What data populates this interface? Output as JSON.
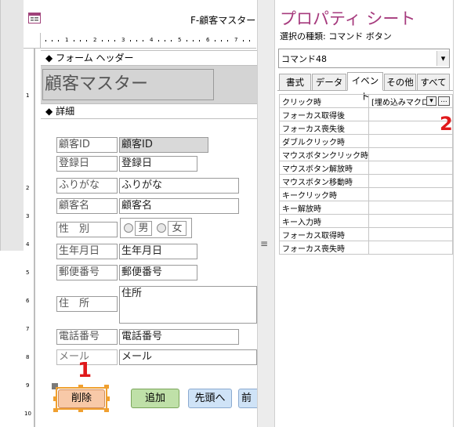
{
  "form": {
    "title": "F-顧客マスター",
    "header_section": "フォーム ヘッダー",
    "header_title": "顧客マスター",
    "detail_section": "詳細",
    "ruler_top": [
      "1",
      "2",
      "3",
      "4",
      "5",
      "6",
      "7"
    ],
    "ruler_left": [
      "1",
      "2",
      "3",
      "4",
      "5",
      "6",
      "7",
      "8",
      "9",
      "10"
    ],
    "fields": [
      {
        "label": "顧客ID",
        "value": "顧客ID"
      },
      {
        "label": "登録日",
        "value": "登録日"
      },
      {
        "label": "ふりがな",
        "value": "ふりがな"
      },
      {
        "label": "顧客名",
        "value": "顧客名"
      },
      {
        "label": "性　別",
        "value": ""
      },
      {
        "label": "生年月日",
        "value": "生年月日"
      },
      {
        "label": "郵便番号",
        "value": "郵便番号"
      },
      {
        "label": "住　所",
        "value": "住所"
      },
      {
        "label": "電話番号",
        "value": "電話番号"
      },
      {
        "label": "メール",
        "value": "メール"
      }
    ],
    "gender_options": [
      "男",
      "女"
    ],
    "buttons": {
      "delete": "削除",
      "add": "追加",
      "first": "先頭へ",
      "prev": "前へ"
    },
    "marker1": "1",
    "marker2": "2"
  },
  "props": {
    "title": "プロパティ シート",
    "selection_type": "選択の種類: コマンド ボタン",
    "selected_object": "コマンド48",
    "tabs": [
      "書式",
      "データ",
      "イベント",
      "その他",
      "すべて"
    ],
    "active_tab": "イベント",
    "rows": [
      {
        "name": "クリック時",
        "value": "[埋め込みマクロ]"
      },
      {
        "name": "フォーカス取得後",
        "value": ""
      },
      {
        "name": "フォーカス喪失後",
        "value": ""
      },
      {
        "name": "ダブルクリック時",
        "value": ""
      },
      {
        "name": "マウスボタンクリック時",
        "value": ""
      },
      {
        "name": "マウスボタン解放時",
        "value": ""
      },
      {
        "name": "マウスボタン移動時",
        "value": ""
      },
      {
        "name": "キークリック時",
        "value": ""
      },
      {
        "name": "キー解放時",
        "value": ""
      },
      {
        "name": "キー入力時",
        "value": ""
      },
      {
        "name": "フォーカス取得時",
        "value": ""
      },
      {
        "name": "フォーカス喪失時",
        "value": ""
      }
    ],
    "builder_glyph": "...",
    "dropdown_glyph": "▾"
  },
  "colors": {
    "marker": "#e0191b",
    "delete_btn_bg": "#f8c9a8",
    "delete_btn_border": "#f0a030",
    "add_btn_bg": "#bfe0a8",
    "first_btn_bg": "#cfe3f7",
    "header_band": "#d4d4d4"
  }
}
